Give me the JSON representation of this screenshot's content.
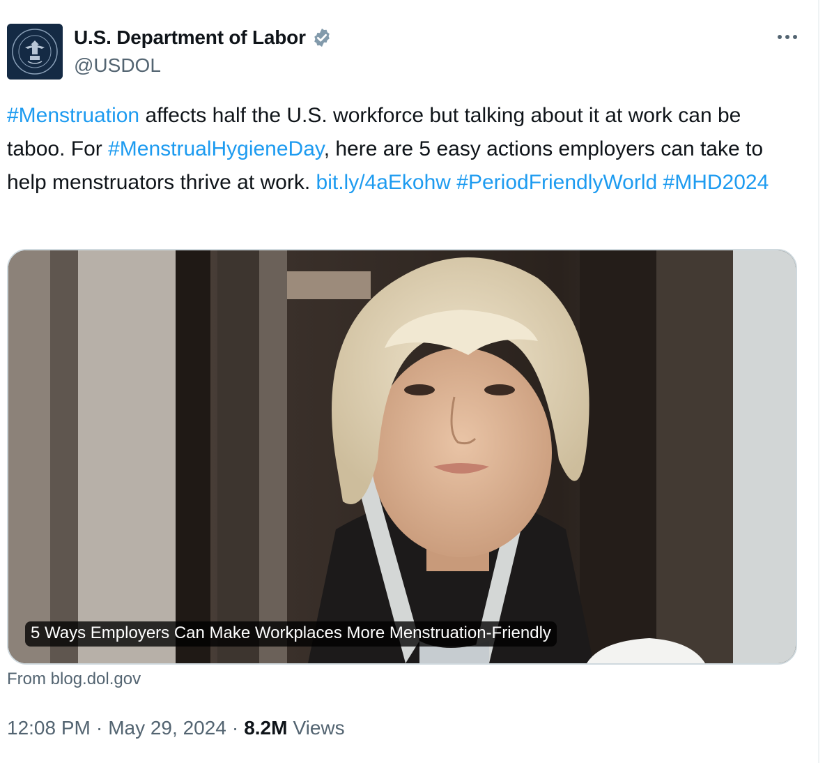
{
  "author": {
    "display_name": "U.S. Department of Labor",
    "handle": "@USDOL",
    "verified": true,
    "avatar_icon": "department-of-labor-seal"
  },
  "more_icon": "ellipsis-icon",
  "tweet": {
    "hashtag_menstruation": "#Menstruation",
    "text_part1": " affects half the U.S. workforce but talking about it at work can be taboo. For ",
    "hashtag_mhday": "#MenstrualHygieneDay",
    "text_part2": ", here are 5 easy actions employers can take to help menstruators thrive at work. ",
    "link": "bit.ly/4aEkohw",
    "hashtag_period": "#PeriodFriendlyWorld",
    "hashtag_mhd2024": "#MHD2024"
  },
  "card": {
    "title": "5 Ways Employers Can Make Workplaces More Menstruation-Friendly",
    "source": "From blog.dol.gov"
  },
  "meta": {
    "time": "12:08 PM",
    "date": "May 29, 2024",
    "separator": "·",
    "views_count": "8.2M",
    "views_label": "Views"
  },
  "colors": {
    "link": "#1d9bf0",
    "secondary_text": "#536471",
    "primary_text": "#0f1419",
    "card_border": "#cfd9de"
  }
}
